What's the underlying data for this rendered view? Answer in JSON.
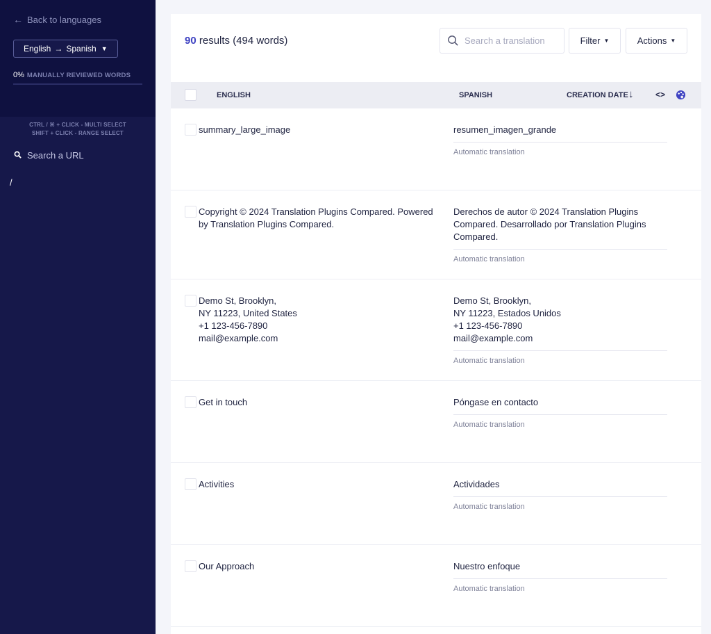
{
  "sidebar": {
    "back_label": "Back to languages",
    "language_pair": {
      "source": "English",
      "target": "Spanish"
    },
    "review_percent": "0%",
    "review_label": "MANUALLY REVIEWED WORDS",
    "review_progress": 0,
    "hint_multi": "CTRL / ⌘ + CLICK - MULTI SELECT",
    "hint_range": "SHIFT + CLICK - RANGE SELECT",
    "url_search_label": "Search a URL",
    "url_item": "/"
  },
  "toolbar": {
    "results_count": "90",
    "results_text": "results (494 words)",
    "search_placeholder": "Search a translation",
    "filter_label": "Filter",
    "actions_label": "Actions"
  },
  "table": {
    "headers": {
      "english": "ENGLISH",
      "spanish": "SPANISH",
      "creation_date": "CREATION DATE"
    },
    "rows": [
      {
        "source": [
          "summary_large_image"
        ],
        "target": [
          "resumen_imagen_grande"
        ],
        "meta": "Automatic translation"
      },
      {
        "source": [
          "Copyright © 2024 Translation Plugins Compared. Powered by Translation Plugins Compared."
        ],
        "target": [
          "Derechos de autor © 2024 Translation Plugins Compared. Desarrollado por Translation Plugins Compared."
        ],
        "meta": "Automatic translation"
      },
      {
        "source": [
          "Demo St, Brooklyn,",
          "NY 11223, United States",
          "+1 123-456-7890",
          "mail@example.com"
        ],
        "target": [
          "Demo St, Brooklyn,",
          "NY 11223, Estados Unidos",
          "+1 123-456-7890",
          "mail@example.com"
        ],
        "meta": "Automatic translation"
      },
      {
        "source": [
          "Get in touch"
        ],
        "target": [
          "Póngase en contacto"
        ],
        "meta": "Automatic translation"
      },
      {
        "source": [
          "Activities"
        ],
        "target": [
          "Actividades"
        ],
        "meta": "Automatic translation"
      },
      {
        "source": [
          "Our Approach"
        ],
        "target": [
          "Nuestro enfoque"
        ],
        "meta": "Automatic translation"
      }
    ]
  }
}
